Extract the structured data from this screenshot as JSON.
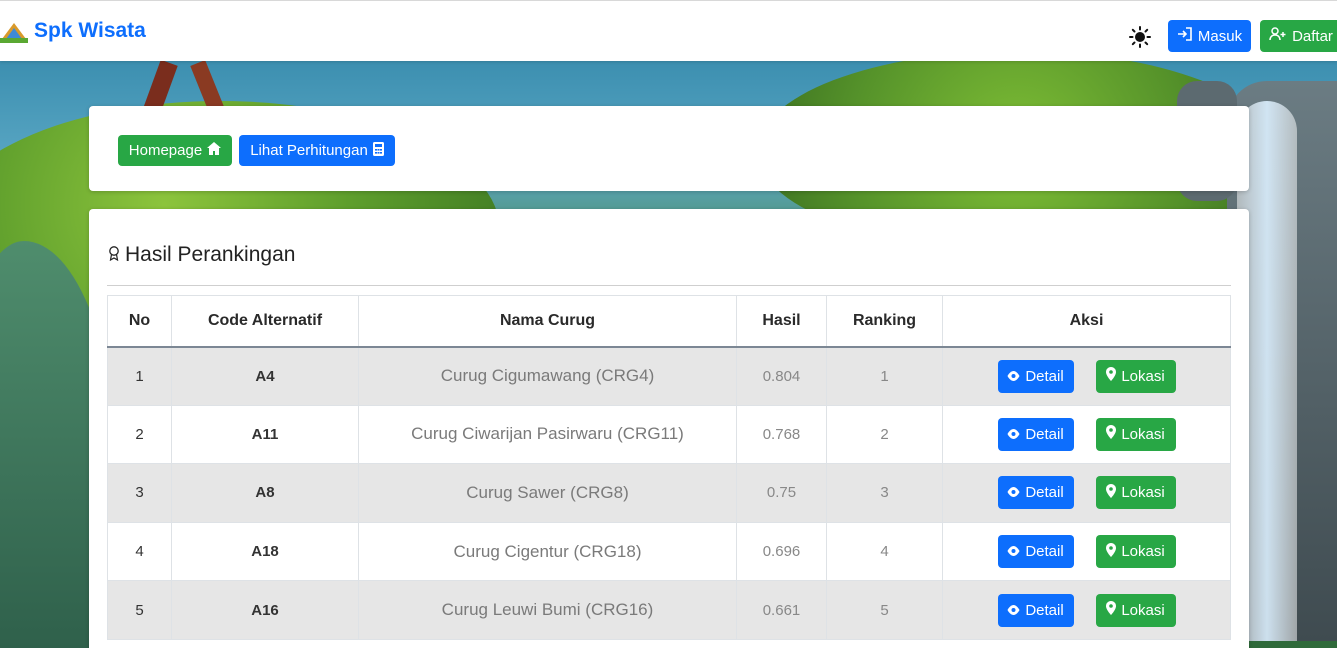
{
  "navbar": {
    "brand": "Spk Wisata",
    "masuk_label": "Masuk",
    "daftar_label": "Daftar"
  },
  "toolbar": {
    "homepage_label": "Homepage",
    "hitung_label": "Lihat Perhitungan"
  },
  "section": {
    "title": "Hasil Perankingan"
  },
  "table": {
    "headers": [
      "No",
      "Code Alternatif",
      "Nama Curug",
      "Hasil",
      "Ranking",
      "Aksi"
    ],
    "rows": [
      {
        "no": "1",
        "code": "A4",
        "nama": "Curug Cigumawang (CRG4)",
        "hasil": "0.804",
        "rank": "1"
      },
      {
        "no": "2",
        "code": "A11",
        "nama": "Curug Ciwarijan Pasirwaru (CRG11)",
        "hasil": "0.768",
        "rank": "2"
      },
      {
        "no": "3",
        "code": "A8",
        "nama": "Curug Sawer (CRG8)",
        "hasil": "0.75",
        "rank": "3"
      },
      {
        "no": "4",
        "code": "A18",
        "nama": "Curug Cigentur (CRG18)",
        "hasil": "0.696",
        "rank": "4"
      },
      {
        "no": "5",
        "code": "A16",
        "nama": "Curug Leuwi Bumi (CRG16)",
        "hasil": "0.661",
        "rank": "5"
      }
    ],
    "detail_label": "Detail",
    "lokasi_label": "Lokasi"
  },
  "colors": {
    "primary": "#0d6efd",
    "success": "#28a745",
    "stripe": "#e6e6e6"
  },
  "icons": [
    "brand-logo-icon",
    "sun-icon",
    "login-icon",
    "user-plus-icon",
    "home-icon",
    "calculator-icon",
    "award-icon",
    "eye-icon",
    "map-pin-icon"
  ]
}
